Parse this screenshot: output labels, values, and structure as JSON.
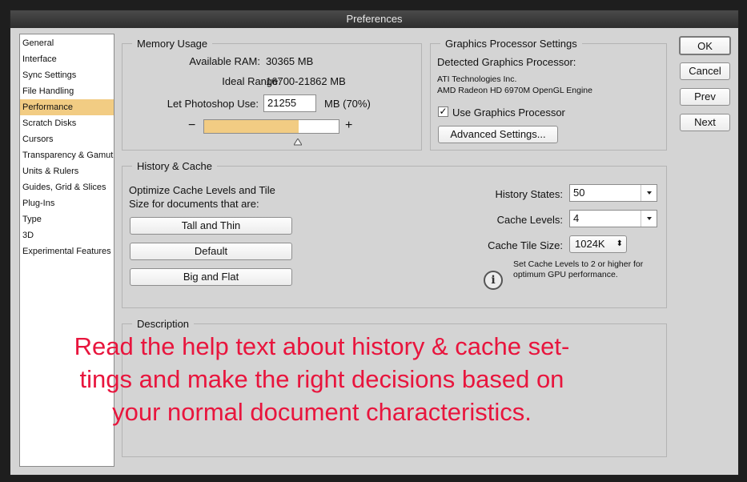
{
  "window": {
    "title": "Preferences"
  },
  "sidebar": {
    "items": [
      {
        "label": "General"
      },
      {
        "label": "Interface"
      },
      {
        "label": "Sync Settings"
      },
      {
        "label": "File Handling"
      },
      {
        "label": "Performance",
        "selected": true
      },
      {
        "label": "Scratch Disks"
      },
      {
        "label": "Cursors"
      },
      {
        "label": "Transparency & Gamut"
      },
      {
        "label": "Units & Rulers"
      },
      {
        "label": "Guides, Grid & Slices"
      },
      {
        "label": "Plug-Ins"
      },
      {
        "label": "Type"
      },
      {
        "label": "3D"
      },
      {
        "label": "Experimental Features"
      }
    ]
  },
  "memory": {
    "title": "Memory Usage",
    "available_label": "Available RAM:",
    "available_value": "30365 MB",
    "ideal_label": "Ideal Range:",
    "ideal_value": "16700-21862 MB",
    "use_label": "Let Photoshop Use:",
    "use_value": "21255",
    "use_unit": "MB (70%)",
    "minus": "−",
    "plus": "+",
    "slider_fraction": 0.7
  },
  "gpu": {
    "title": "Graphics Processor Settings",
    "detected_label": "Detected Graphics Processor:",
    "vendor": "ATI Technologies Inc.",
    "model": "AMD Radeon HD 6970M OpenGL Engine",
    "use_checkbox": "Use Graphics Processor",
    "checked_glyph": "✓",
    "advanced_button": "Advanced Settings..."
  },
  "history": {
    "title": "History & Cache",
    "optimize_line1": "Optimize Cache Levels and Tile",
    "optimize_line2": "Size for documents that are:",
    "btn_tall": "Tall and Thin",
    "btn_default": "Default",
    "btn_big": "Big and Flat",
    "states_label": "History States:",
    "states_value": "50",
    "levels_label": "Cache Levels:",
    "levels_value": "4",
    "tile_label": "Cache Tile Size:",
    "tile_value": "1024K",
    "tile_arrows": "⬍",
    "hint_line1": "Set Cache Levels to 2 or higher for",
    "hint_line2": "optimum GPU performance.",
    "info_glyph": "i"
  },
  "description": {
    "title": "Description"
  },
  "buttons": {
    "ok": "OK",
    "cancel": "Cancel",
    "prev": "Prev",
    "next": "Next"
  },
  "overlay": {
    "line1": "Read the help text about history & cache set-",
    "line2": "tings and make the right decisions based on",
    "line3": "your normal document characteristics."
  },
  "colors": {
    "accent": "#f2cc83",
    "overlay_text": "#e8153d",
    "panel": "#d4d4d4"
  }
}
